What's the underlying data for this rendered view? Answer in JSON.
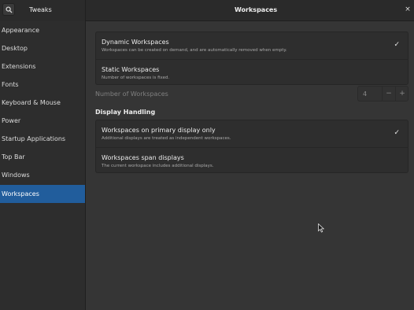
{
  "app": {
    "title": "Tweaks",
    "page_title": "Workspaces"
  },
  "header": {
    "search_icon": "search-icon",
    "close_icon": "close-icon",
    "close_glyph": "×"
  },
  "sidebar": {
    "items": [
      {
        "label": "Appearance",
        "active": false
      },
      {
        "label": "Desktop",
        "active": false
      },
      {
        "label": "Extensions",
        "active": false
      },
      {
        "label": "Fonts",
        "active": false
      },
      {
        "label": "Keyboard & Mouse",
        "active": false
      },
      {
        "label": "Power",
        "active": false
      },
      {
        "label": "Startup Applications",
        "active": false
      },
      {
        "label": "Top Bar",
        "active": false
      },
      {
        "label": "Windows",
        "active": false
      },
      {
        "label": "Workspaces",
        "active": true
      }
    ]
  },
  "workspaces": {
    "dynamic": {
      "title": "Dynamic Workspaces",
      "subtitle": "Workspaces can be created on demand, and are automatically removed when empty.",
      "checked": true
    },
    "static": {
      "title": "Static Workspaces",
      "subtitle": "Number of workspaces is fixed.",
      "checked": false
    },
    "number_label": "Number of Workspaces",
    "number_value": "4",
    "minus_label": "−",
    "plus_label": "+"
  },
  "display_handling": {
    "heading": "Display Handling",
    "primary_only": {
      "title": "Workspaces on primary display only",
      "subtitle": "Additional displays are treated as independent workspaces.",
      "checked": true
    },
    "span_displays": {
      "title": "Workspaces span displays",
      "subtitle": "The current workspace includes additional displays.",
      "checked": false
    }
  },
  "check_glyph": "✓",
  "colors": {
    "accent": "#215d9c",
    "background": "#353535",
    "sidebar": "#2d2d2d"
  }
}
